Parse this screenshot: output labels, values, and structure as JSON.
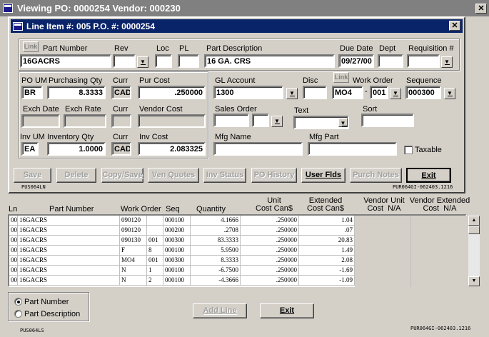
{
  "window": {
    "title": "Viewing PO: 0000254  Vendor: 000230"
  },
  "dialog": {
    "title": "Line Item #: 005    P.O. #: 0000254"
  },
  "fields": {
    "link1": "Link",
    "part_number_label": "Part Number",
    "part_number": "16GACRS",
    "rev_label": "Rev",
    "rev": "",
    "loc_label": "Loc",
    "loc": "",
    "pl_label": "PL",
    "pl": "",
    "part_desc_label": "Part Description",
    "part_desc": "16 GA. CRS",
    "due_date_label": "Due Date",
    "due_date": "09/27/00",
    "dept_label": "Dept",
    "dept": "",
    "req_label": "Requisition #",
    "req": "",
    "po_um_label": "PO UM",
    "po_um": "BR",
    "purch_qty_label": "Purchasing Qty",
    "purch_qty": "8.3333",
    "curr_label": "Curr",
    "curr1": "CAD",
    "pur_cost_label": "Pur Cost",
    "pur_cost": ".250000",
    "exch_date_label": "Exch Date",
    "exch_rate_label": "Exch Rate",
    "curr2_label": "Curr",
    "vendor_cost_label": "Vendor Cost",
    "inv_um_label": "Inv UM",
    "inv_um": "EA",
    "inv_qty_label": "Inventory Qty",
    "inv_qty": "1.0000",
    "curr3_label": "Curr",
    "curr3": "CAD",
    "inv_cost_label": "Inv Cost",
    "inv_cost": "2.083325",
    "gl_label": "GL Account",
    "gl": "1300",
    "disc_label": "Disc",
    "disc": "",
    "link2": "Link",
    "work_order_label": "Work Order",
    "work_order": "MO4",
    "wo_dash": "-",
    "wo_suffix": "001",
    "sequence_label": "Sequence",
    "sequence": "000300",
    "sales_order_label": "Sales Order",
    "text_label": "Text",
    "sort_label": "Sort",
    "mfg_name_label": "Mfg Name",
    "mfg_part_label": "Mfg Part",
    "taxable_label": "Taxable"
  },
  "buttons": {
    "save": "Save",
    "delete": "Delete",
    "copy_save": "Copy/Save",
    "ven_quotes": "Ven Quotes",
    "inv_status": "Inv Status",
    "po_history": "PO History",
    "user_flds": "User Flds",
    "purch_notes": "Purch Notes",
    "exit": "Exit",
    "add_line": "Add Line",
    "exit2": "Exit"
  },
  "codes": {
    "left1": "PUS064LN",
    "right1": "PUR064GI-062403.1216",
    "left2": "PUS064LS",
    "right2": "PUR064GI-062403.1216"
  },
  "grid": {
    "headers": {
      "ln": "Ln",
      "part": "Part Number",
      "wo": "Work Order",
      "seq": "Seq",
      "qty": "Quantity",
      "unit_cost": "Unit\nCost Can$",
      "ext_cost": "Extended\nCost Can$",
      "vu_cost": "Vendor Unit\nCost  N/A",
      "ve_cost": "Vendor Extended\nCost  N/A"
    },
    "rows": [
      {
        "ln": "001",
        "part": "16GACRS",
        "wo": "090120",
        "wo2": "",
        "seq": "000100",
        "qty": "4.1666",
        "unit": ".250000",
        "ext": "1.04"
      },
      {
        "ln": "002",
        "part": "16GACRS",
        "wo": "090120",
        "wo2": "",
        "seq": "000200",
        "qty": ".2708",
        "unit": ".250000",
        "ext": ".07"
      },
      {
        "ln": "003",
        "part": "16GACRS",
        "wo": "090130",
        "wo2": "001",
        "seq": "000300",
        "qty": "83.3333",
        "unit": ".250000",
        "ext": "20.83"
      },
      {
        "ln": "004",
        "part": "16GACRS",
        "wo": "F",
        "wo2": "8",
        "seq": "000100",
        "qty": "5.9500",
        "unit": ".250000",
        "ext": "1.49"
      },
      {
        "ln": "005",
        "part": "16GACRS",
        "wo": "MO4",
        "wo2": "001",
        "seq": "000300",
        "qty": "8.3333",
        "unit": ".250000",
        "ext": "2.08"
      },
      {
        "ln": "006",
        "part": "16GACRS",
        "wo": "N",
        "wo2": "1",
        "seq": "000100",
        "qty": "-6.7500",
        "unit": ".250000",
        "ext": "-1.69"
      },
      {
        "ln": "007",
        "part": "16GACRS",
        "wo": "N",
        "wo2": "2",
        "seq": "000100",
        "qty": "-4.3666",
        "unit": ".250000",
        "ext": "-1.09"
      }
    ]
  },
  "sort": {
    "opt1": "Part Number",
    "opt2": "Part Description",
    "selected": "Part Number"
  }
}
